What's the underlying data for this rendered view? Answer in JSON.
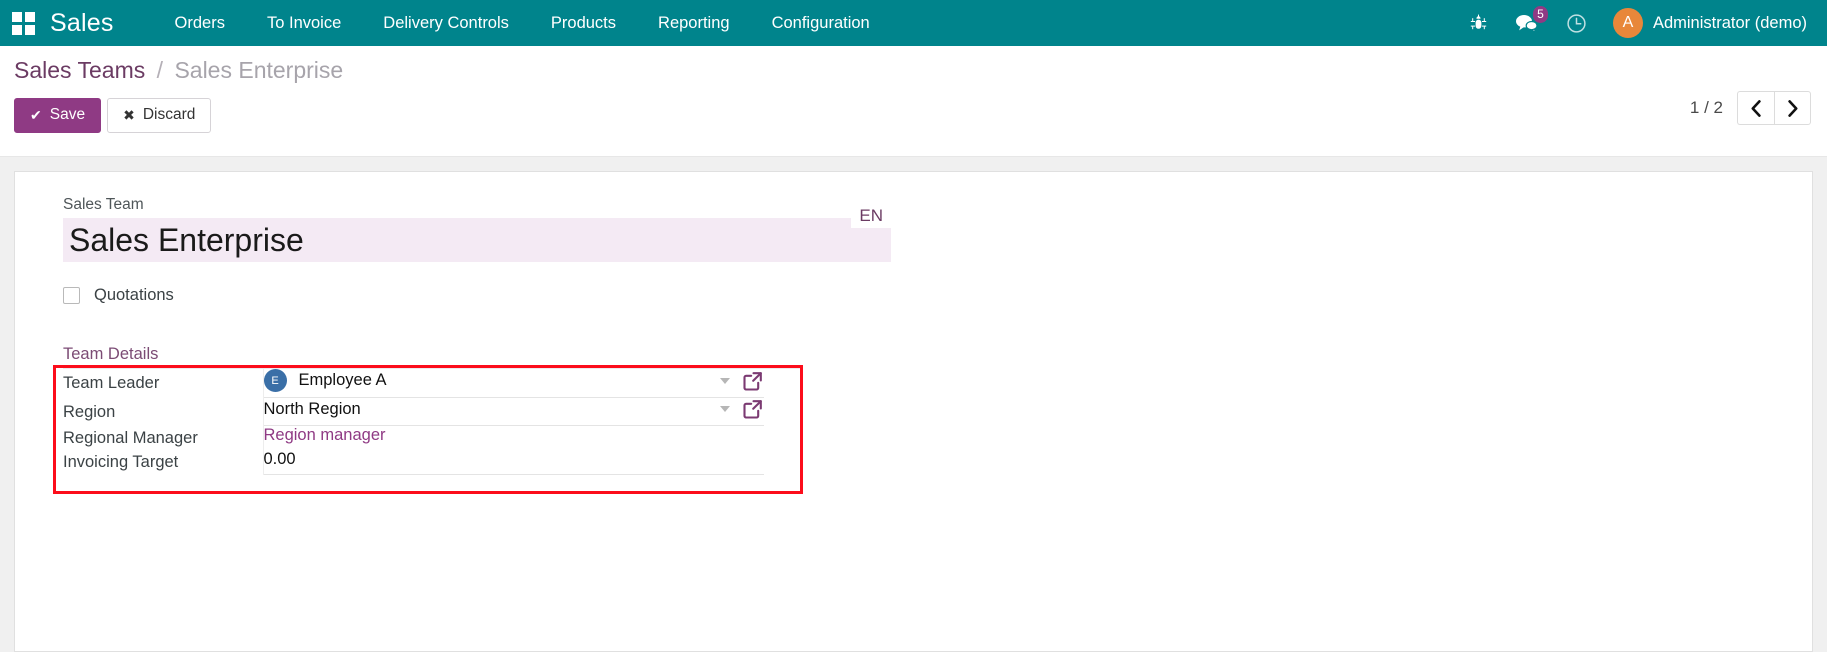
{
  "navbar": {
    "apps_icon": "apps-grid-icon",
    "brand": "Sales",
    "menu": [
      {
        "label": "Orders"
      },
      {
        "label": "To Invoice"
      },
      {
        "label": "Delivery Controls"
      },
      {
        "label": "Products"
      },
      {
        "label": "Reporting"
      },
      {
        "label": "Configuration"
      }
    ],
    "icons": {
      "debug": "bug-icon",
      "messages": "messages-icon",
      "messages_badge": "5",
      "activities": "clock-icon"
    },
    "user": {
      "avatar_initial": "A",
      "name": "Administrator (demo)"
    }
  },
  "control_panel": {
    "breadcrumb": {
      "root": "Sales Teams",
      "separator": "/",
      "current": "Sales Enterprise"
    },
    "save_label": "Save",
    "discard_label": "Discard",
    "pager": {
      "count": "1 / 2",
      "prev_icon": "chevron-left-icon",
      "next_icon": "chevron-right-icon"
    }
  },
  "form": {
    "title_field": {
      "label": "Sales Team",
      "value": "Sales Enterprise",
      "lang_badge": "EN"
    },
    "quotations": {
      "label": "Quotations",
      "checked": false
    },
    "section_title": "Team Details",
    "rows": [
      {
        "label": "Team Leader",
        "value": "Employee A",
        "avatar_initial": "E",
        "type": "many2one"
      },
      {
        "label": "Region",
        "value": "North Region",
        "type": "many2one"
      },
      {
        "label": "Regional Manager",
        "value": "Region manager",
        "type": "link"
      },
      {
        "label": "Invoicing Target",
        "value": "0.00",
        "type": "number"
      }
    ]
  },
  "colors": {
    "navbar": "#00848c",
    "accent_purple": "#8f3a84",
    "highlight_red": "#fc0d1b",
    "title_bg": "#f4eaf4",
    "avatar_orange": "#e8873a",
    "avatar_blue": "#3a6fa7"
  }
}
